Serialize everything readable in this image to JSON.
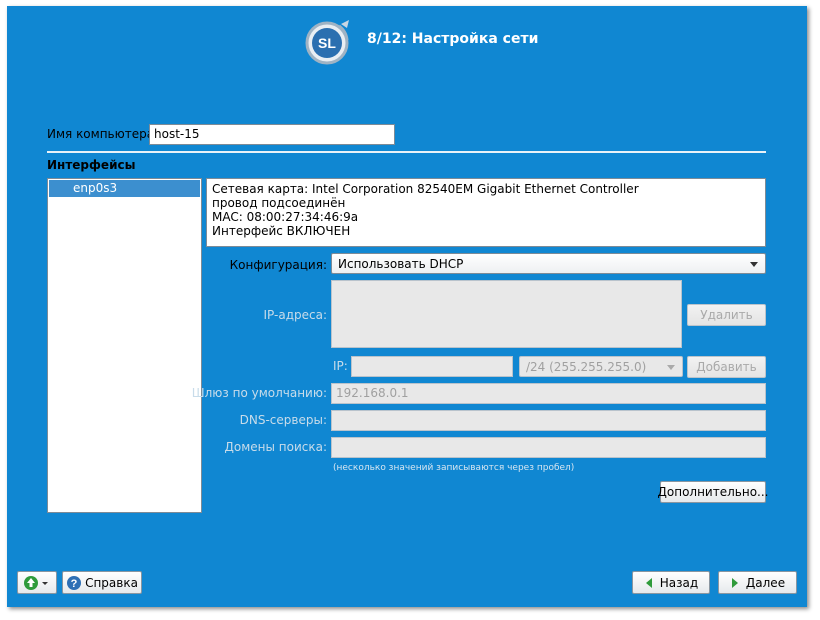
{
  "header": {
    "title": "8/12: Настройка сети",
    "logo_text": "SL"
  },
  "hostname": {
    "label": "Имя компьютера:",
    "value": "host-15"
  },
  "interfaces": {
    "heading": "Интерфейсы",
    "items": [
      {
        "name": "enp0s3"
      }
    ],
    "info_lines": [
      "Сетевая карта: Intel Corporation 82540EM Gigabit Ethernet Controller",
      "провод подсоединён",
      "MAC: 08:00:27:34:46:9a",
      "Интерфейс ВКЛЮЧЕН"
    ]
  },
  "config": {
    "label": "Конфигурация:",
    "value": "Использовать DHCP"
  },
  "ip": {
    "addresses_label": "IP-адреса:",
    "delete_label": "Удалить",
    "ip_label": "IP:",
    "ip_value": "",
    "mask_value": "/24 (255.255.255.0)",
    "add_label": "Добавить"
  },
  "gateway": {
    "label": "Шлюз по умолчанию:",
    "value": "192.168.0.1"
  },
  "dns": {
    "label": "DNS-серверы:",
    "value": ""
  },
  "search": {
    "label": "Домены поиска:",
    "value": "",
    "hint": "(несколько значений записываются через пробел)"
  },
  "advanced_label": "Дополнительно...",
  "footer": {
    "help_label": "Справка",
    "back_label": "Назад",
    "next_label": "Далее"
  },
  "colors": {
    "window_bg": "#1087d2",
    "selection": "#3c8fcf",
    "nav_arrow": "#2f9b3b",
    "help_icon": "#2e6fb5"
  }
}
